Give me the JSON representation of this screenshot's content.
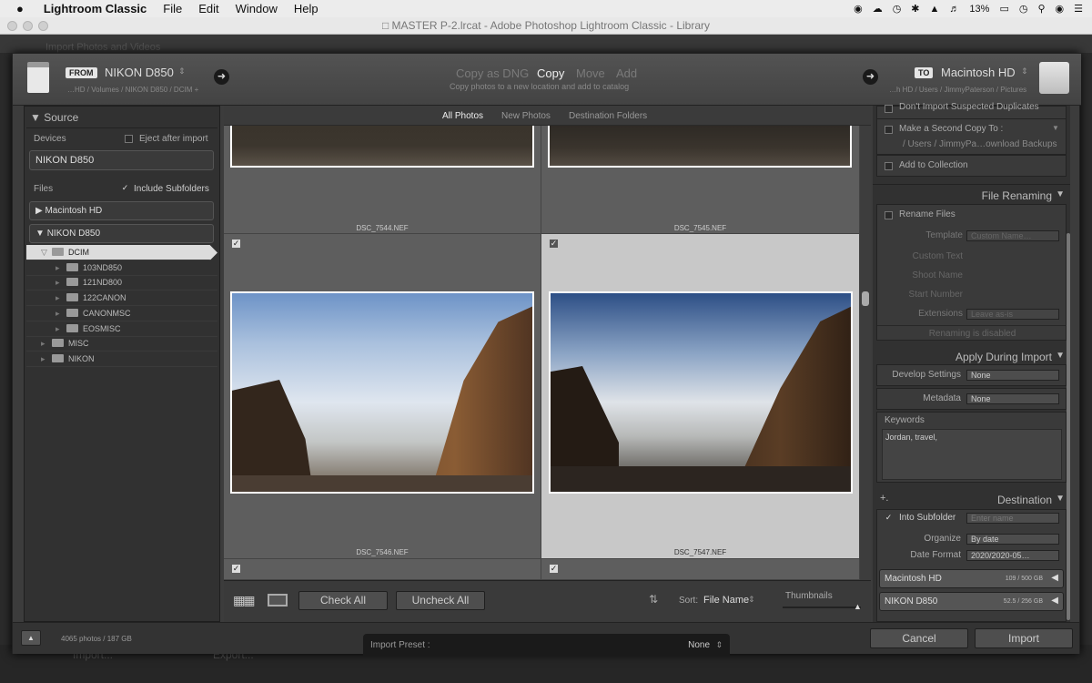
{
  "menubar": {
    "app": "Lightroom Classic",
    "items": [
      "File",
      "Edit",
      "Window",
      "Help"
    ],
    "battery": "13%"
  },
  "window": {
    "title": "MASTER P-2.lrcat - Adobe Photoshop Lightroom Classic - Library",
    "bg_top_text": "Import Photos and Videos",
    "bg_bottom_left": "Import...",
    "bg_bottom_mid": "Export..."
  },
  "header": {
    "from_tag": "FROM",
    "from_name": "NIKON D850",
    "from_path": "…HD / Volumes / NIKON D850 / DCIM +",
    "modes": [
      "Copy as DNG",
      "Copy",
      "Move",
      "Add"
    ],
    "active_mode": "Copy",
    "mode_desc": "Copy photos to a new location and add to catalog",
    "to_tag": "TO",
    "to_name": "Macintosh HD",
    "to_path": "…h HD / Users / JimmyPaterson / Pictures"
  },
  "left": {
    "source_title": "Source",
    "devices_label": "Devices",
    "eject_label": "Eject after import",
    "device_name": "NIKON D850",
    "files_label": "Files",
    "include_sub_label": "Include Subfolders",
    "vol1": "Macintosh HD",
    "vol2": "NIKON D850",
    "tree": [
      {
        "name": "DCIM",
        "indent": 1,
        "selected": true,
        "arrow": "▽"
      },
      {
        "name": "103ND850",
        "indent": 2
      },
      {
        "name": "121ND800",
        "indent": 2
      },
      {
        "name": "122CANON",
        "indent": 2
      },
      {
        "name": "CANONMSC",
        "indent": 2
      },
      {
        "name": "EOSMISC",
        "indent": 2
      },
      {
        "name": "MISC",
        "indent": 1
      },
      {
        "name": "NIKON",
        "indent": 1,
        "arrow": "▸"
      }
    ]
  },
  "center": {
    "tabs": [
      "All Photos",
      "New Photos",
      "Destination Folders"
    ],
    "photos": [
      "DSC_7544.NEF",
      "DSC_7545.NEF",
      "DSC_7546.NEF",
      "DSC_7547.NEF"
    ],
    "check_all": "Check All",
    "uncheck_all": "Uncheck All",
    "sort_label": "Sort:",
    "sort_value": "File Name",
    "thumbnails_label": "Thumbnails"
  },
  "right": {
    "dont_import": "Don't Import Suspected Duplicates",
    "second_copy": "Make a Second Copy To :",
    "second_copy_path": "/ Users / JimmyPa…ownload Backups",
    "add_collection": "Add to Collection",
    "file_renaming_title": "File Renaming",
    "rename_files": "Rename Files",
    "template_label": "Template",
    "template_value": "Custom Name…",
    "custom_text": "Custom Text",
    "shoot_name": "Shoot Name",
    "start_number": "Start Number",
    "extensions_label": "Extensions",
    "extensions_value": "Leave as-is",
    "renaming_disabled": "Renaming is disabled",
    "apply_title": "Apply During Import",
    "develop_label": "Develop Settings",
    "develop_value": "None",
    "metadata_label": "Metadata",
    "metadata_value": "None",
    "keywords_label": "Keywords",
    "keywords_value": "Jordan, travel,",
    "destination_title": "Destination",
    "plus": "+.",
    "into_subfolder": "Into Subfolder",
    "subfolder_placeholder": "Enter name",
    "organize_label": "Organize",
    "organize_value": "By date",
    "date_format_label": "Date Format",
    "date_format_value": "2020/2020-05…",
    "drive1_name": "Macintosh HD",
    "drive1_space": "109 / 500 GB",
    "drive2_name": "NIKON D850",
    "drive2_space": "52.5 / 256 GB"
  },
  "footer": {
    "photo_count": "4065 photos / 187 GB",
    "preset_label": "Import Preset :",
    "preset_value": "None",
    "cancel": "Cancel",
    "import": "Import"
  }
}
